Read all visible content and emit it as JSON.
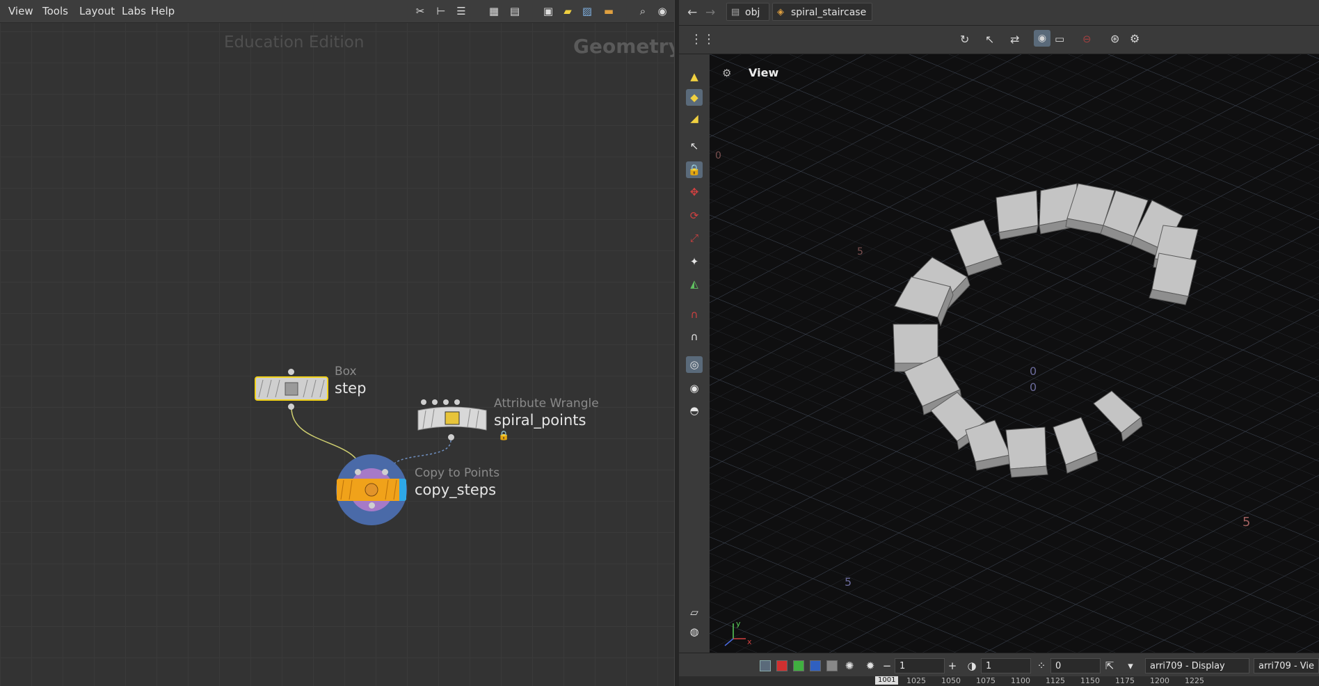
{
  "network": {
    "menu": [
      "View",
      "Tools",
      "Layout",
      "Labs",
      "Help"
    ],
    "watermark": "Education Edition",
    "context_label": "Geometry",
    "nodes": [
      {
        "type": "Box",
        "name": "step"
      },
      {
        "type": "Attribute Wrangle",
        "name": "spiral_points"
      },
      {
        "type": "Copy to Points",
        "name": "copy_steps"
      }
    ]
  },
  "viewer": {
    "path": {
      "root": "obj",
      "node": "spiral_staircase"
    },
    "view_label": "View",
    "grid_labels": [
      "0",
      "0",
      "5",
      "5",
      "5",
      "0",
      "0"
    ],
    "axis_labels": [
      "y",
      "x"
    ]
  },
  "bottom_bar": {
    "field_a": "1",
    "field_b": "1",
    "field_c": "0",
    "display_lut": "arri709 - Display",
    "view_lut": "arri709 - Vie",
    "current_frame": "1001",
    "ticks": [
      "1025",
      "1050",
      "1075",
      "1100",
      "1125",
      "1150",
      "1175",
      "1200",
      "1225"
    ]
  },
  "colors": {
    "copy_node_orange": "#f0a21a",
    "selected_outline": "#f2d21a",
    "viewport_bg": "#0f0f10"
  }
}
